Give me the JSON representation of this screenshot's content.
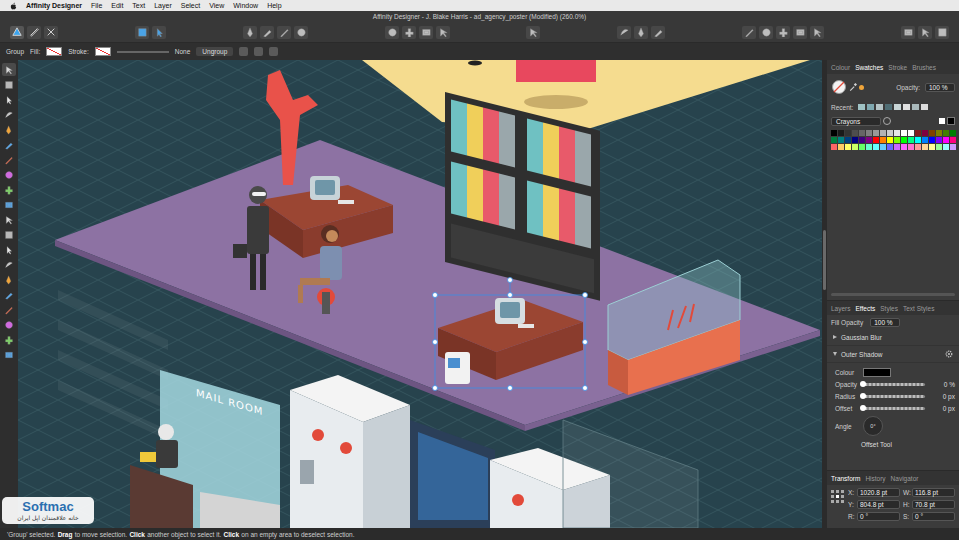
{
  "menubar": {
    "app": "Affinity Designer",
    "items": [
      "File",
      "Edit",
      "Text",
      "Layer",
      "Select",
      "View",
      "Window",
      "Help"
    ]
  },
  "window": {
    "title": "Affinity Designer - J. Blake Harris - ad_agency_poster (Modified) (260.0%)"
  },
  "personas": [
    {
      "selected": true
    },
    {
      "selected": false
    },
    {
      "selected": false
    }
  ],
  "context_toolbar": {
    "selection": "Group",
    "fill_label": "Fill:",
    "stroke_label": "Stroke:",
    "stroke_width": "None",
    "button": "Ungroup"
  },
  "tools": [
    {
      "selected": true
    },
    {
      "selected": false
    },
    {
      "selected": false
    },
    {
      "selected": false
    },
    {
      "selected": false
    },
    {
      "selected": false
    },
    {
      "selected": false
    },
    {
      "selected": false
    },
    {
      "selected": false
    },
    {
      "selected": false
    },
    {
      "selected": false
    },
    {
      "selected": false
    },
    {
      "selected": false
    },
    {
      "selected": false
    },
    {
      "selected": false
    },
    {
      "selected": false
    },
    {
      "selected": false
    },
    {
      "selected": false
    },
    {
      "selected": false
    },
    {
      "selected": false
    }
  ],
  "colour_panel": {
    "tabs": [
      {
        "label": "Colour",
        "selected": false
      },
      {
        "label": "Swatches",
        "selected": true
      },
      {
        "label": "Stroke",
        "selected": false
      },
      {
        "label": "Brushes",
        "selected": false
      }
    ],
    "opacity_label": "Opacity:",
    "opacity": "100 %",
    "recent_label": "Recent:",
    "recent": [
      "#9fc2c4",
      "#7fa8b0",
      "#b5c4c6",
      "#4f6d74",
      "#c8d5d6",
      "#e0e0e0",
      "#a9b9bb",
      "#dcdcdc"
    ],
    "palette": "Crayons",
    "swatches": [
      "#000000",
      "#1a1a1a",
      "#333333",
      "#4d4d4d",
      "#666666",
      "#808080",
      "#999999",
      "#b3b3b3",
      "#cccccc",
      "#e6e6e6",
      "#ffffff",
      "#ffffff",
      "#7f1d1d",
      "#800040",
      "#804000",
      "#808000",
      "#408000",
      "#008000",
      "#008040",
      "#008080",
      "#004080",
      "#000080",
      "#400080",
      "#800080",
      "#ff0000",
      "#ff8000",
      "#ffff00",
      "#80ff00",
      "#00ff00",
      "#00ff80",
      "#00ffff",
      "#0080ff",
      "#0000ff",
      "#8000ff",
      "#ff00ff",
      "#ff0080",
      "#ff6666",
      "#ffcc66",
      "#ffff66",
      "#ccff66",
      "#66ff66",
      "#66ffcc",
      "#66ffff",
      "#66ccff",
      "#6666ff",
      "#cc66ff",
      "#ff66ff",
      "#ff6fcf",
      "#ff9999",
      "#ffd699",
      "#ffff99",
      "#99ff99",
      "#99ffff",
      "#cc99ff"
    ]
  },
  "effects_panel": {
    "tabs": [
      {
        "label": "Layers",
        "selected": false
      },
      {
        "label": "Effects",
        "selected": true
      },
      {
        "label": "Styles",
        "selected": false
      },
      {
        "label": "Text Styles",
        "selected": false
      }
    ],
    "fill_opacity_label": "Fill Opacity",
    "fill_opacity": "100 %",
    "effects": [
      {
        "label": "Gaussian Blur",
        "expanded": false
      },
      {
        "label": "Outer Shadow",
        "expanded": true
      }
    ],
    "settings": {
      "colour_label": "Colour",
      "colour": "#000000",
      "sliders": [
        {
          "label": "Opacity",
          "level": 0,
          "reading": "0 %"
        },
        {
          "label": "Radius",
          "level": 0,
          "reading": "0 px"
        },
        {
          "label": "Offset",
          "level": 0,
          "reading": "0 px"
        }
      ],
      "angle_label": "Angle",
      "angle": "0°",
      "offset_tool": "Offset Tool"
    }
  },
  "transform_panel": {
    "tabs": [
      {
        "label": "Transform",
        "selected": true
      },
      {
        "label": "History",
        "selected": false
      },
      {
        "label": "Navigator",
        "selected": false
      }
    ],
    "fields": [
      {
        "label": "X:",
        "value": "1020.8 pt"
      },
      {
        "label": "W:",
        "value": "116.8 pt"
      },
      {
        "label": "Y:",
        "value": "804.8 pt"
      },
      {
        "label": "H:",
        "value": "70.8 pt"
      },
      {
        "label": "R:",
        "value": "0 °"
      },
      {
        "label": "S:",
        "value": "0 °"
      }
    ]
  },
  "canvas": {
    "sign": "MAIL ROOM"
  },
  "status_bar": [
    {
      "text": "'Group' selected.",
      "bold": false
    },
    {
      "text": "Drag",
      "bold": true
    },
    {
      "text": "to move selection.",
      "bold": false
    },
    {
      "text": "Click",
      "bold": true
    },
    {
      "text": "another object to select it.",
      "bold": false
    },
    {
      "text": "Click",
      "bold": true
    },
    {
      "text": "on an empty area to deselect selection.",
      "bold": false
    }
  ],
  "watermark": {
    "brand": "Softmac",
    "tagline": "خانه علاقمندان اپل ایران"
  }
}
